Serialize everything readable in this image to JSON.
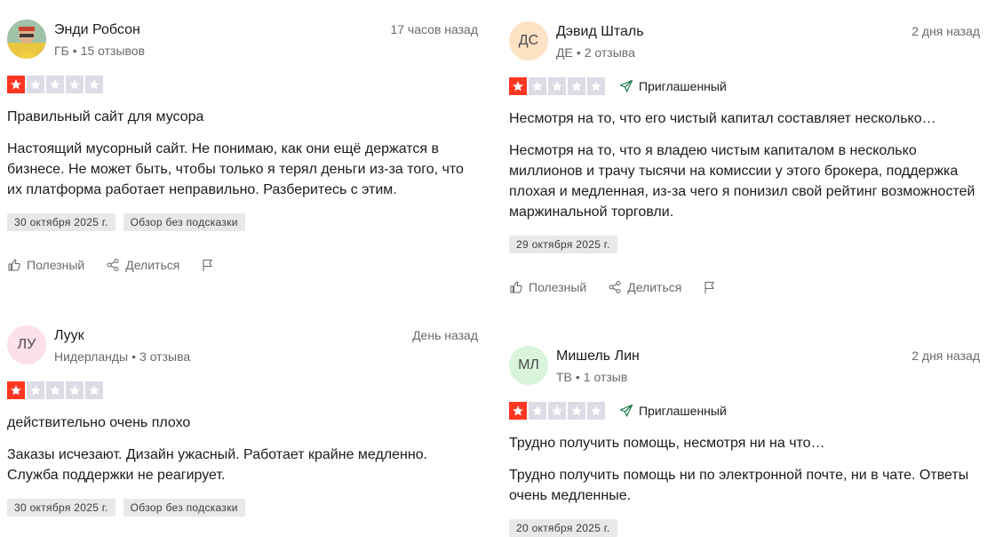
{
  "colors": {
    "star_filled": "#ff3722",
    "star_empty": "#dcdce6",
    "invited_icon": "#1a7a4c"
  },
  "labels": {
    "helpful": "Полезный",
    "share": "Делиться",
    "invited": "Приглашенный"
  },
  "reviews": [
    {
      "name": "Энди Робсон",
      "country": "ГБ",
      "reviews_count": "15 отзывов",
      "time": "17 часов назад",
      "rating": 1,
      "title": "Правильный сайт для мусора",
      "body": "Настоящий мусорный сайт. Не понимаю, как они ещё держатся в бизнесе. Не может быть, чтобы только я терял деньги из-за того, что их платформа работает неправильно. Разберитесь с этим.",
      "date": "30 октября 2025 г.",
      "tag": "Обзор без подсказки"
    },
    {
      "name": "Дэвид Шталь",
      "initials": "ДС",
      "avatar_color": "#fde2c4",
      "country": "ДЕ",
      "reviews_count": "2 отзыва",
      "time": "2 дня назад",
      "rating": 1,
      "title": "Несмотря на то, что его чистый капитал составляет несколько…",
      "body": "Несмотря на то, что я владею чистым капиталом в несколько миллионов и трачу тысячи на комиссии у этого брокера, поддержка плохая и медленная, из-за чего я понизил свой рейтинг возможностей маржинальной торговли.",
      "date": "29 октября 2025 г."
    },
    {
      "name": "Луук",
      "initials": "ЛУ",
      "avatar_color": "#fde0e8",
      "country": "Нидерланды",
      "reviews_count": "3 отзыва",
      "time": "День назад",
      "rating": 1,
      "title": "действительно очень плохо",
      "body": "Заказы исчезают. Дизайн ужасный. Работает крайне медленно. Служба поддержки не реагирует.",
      "date": "30 октября 2025 г.",
      "tag": "Обзор без подсказки"
    },
    {
      "name": "Мишель Лин",
      "initials": "МЛ",
      "avatar_color": "#d8f5dc",
      "country": "ТВ",
      "reviews_count": "1 отзыв",
      "time": "2 дня назад",
      "rating": 1,
      "title": "Трудно получить помощь, несмотря ни на что…",
      "body": "Трудно получить помощь ни по электронной почте, ни в чате. Ответы очень медленные.",
      "date": "20 октября 2025 г."
    }
  ]
}
